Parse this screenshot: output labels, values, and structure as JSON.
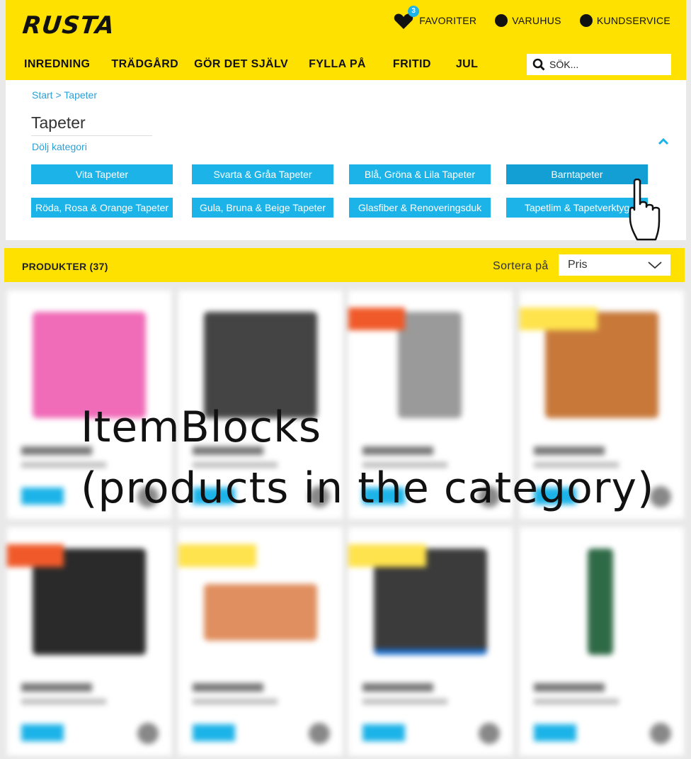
{
  "brand": {
    "logo": "RUSTA",
    "accent": "#ffe100",
    "link_color": "#1cb3e8"
  },
  "top_links": {
    "favorites": {
      "label": "FAVORITER",
      "count": "3"
    },
    "stores": "VARUHUS",
    "support": "KUNDSERVICE"
  },
  "nav": [
    "INREDNING",
    "TRÄDGÅRD",
    "GÖR DET SJÄLV",
    "FYLLA PÅ",
    "FRITID",
    "JUL"
  ],
  "search": {
    "placeholder": "SÖK..."
  },
  "breadcrumb": {
    "home": "Start",
    "separator": " > ",
    "current": "Tapeter"
  },
  "category": {
    "title": "Tapeter",
    "toggle_label": "Dölj kategori",
    "subcategories": [
      "Vita Tapeter",
      "Svarta & Gråa Tapeter",
      "Blå, Gröna & Lila Tapeter",
      "Barntapeter",
      "Röda, Rosa & Orange Tapeter",
      "Gula, Bruna & Beige Tapeter",
      "Glasfiber & Renoveringsduk",
      "Tapetlim & Tapetverktyg"
    ]
  },
  "products_bar": {
    "label": "PRODUKTER (37)",
    "sort_label": "Sortera på",
    "sort_value": "Pris"
  },
  "annotation": {
    "line1": "ItemBlocks",
    "line2": "(products in the category)"
  }
}
